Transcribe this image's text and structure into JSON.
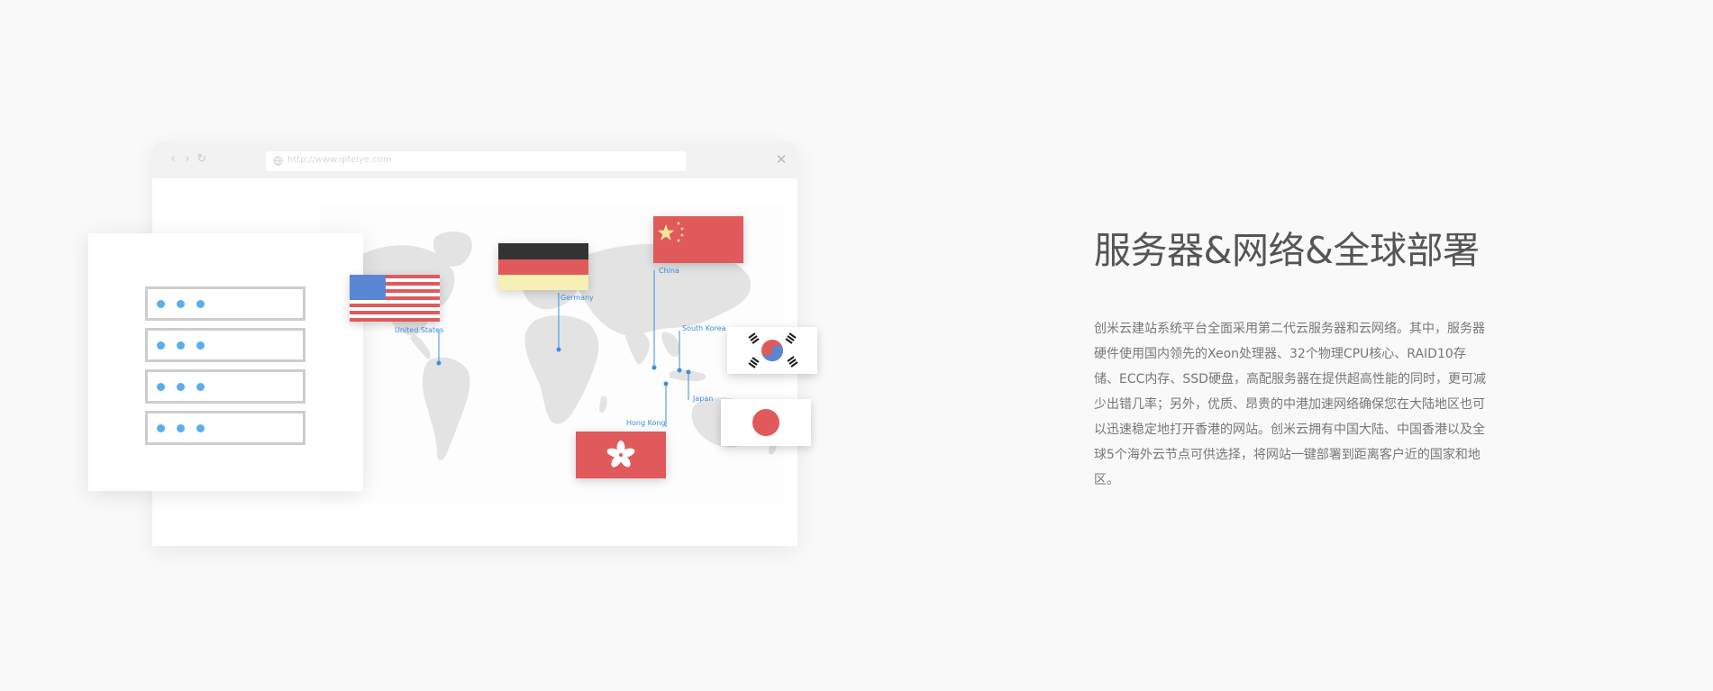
{
  "browser": {
    "address_text": "http://www.qifeiye.com",
    "back_icon": "chevron-left-icon",
    "forward_icon": "chevron-right-icon",
    "reload_icon": "reload-icon",
    "close_icon": "close-icon"
  },
  "map": {
    "locations": [
      {
        "name": "United States",
        "flag": "us"
      },
      {
        "name": "Germany",
        "flag": "de"
      },
      {
        "name": "China",
        "flag": "cn"
      },
      {
        "name": "South Korea",
        "flag": "kr"
      },
      {
        "name": "Japan",
        "flag": "jp"
      },
      {
        "name": "Hong Kong",
        "flag": "hk"
      }
    ],
    "marker_color": "#3a8fe0",
    "continent_color": "#e3e3e3"
  },
  "server": {
    "rack_count": 4,
    "led_color": "#5aaef0"
  },
  "content": {
    "title": "服务器&网络&全球部署",
    "description": "创米云建站系统平台全面采用第二代云服务器和云网络。其中，服务器硬件使用国内领先的Xeon处理器、32个物理CPU核心、RAID10存储、ECC内存、SSD硬盘，高配服务器在提供超高性能的同时，更可减少出错几率；另外，优质、昂贵的中港加速网络确保您在大陆地区也可以迅速稳定地打开香港的网站。创米云拥有中国大陆、中国香港以及全球5个海外云节点可供选择，将网站一键部署到距离客户近的国家和地区。"
  }
}
